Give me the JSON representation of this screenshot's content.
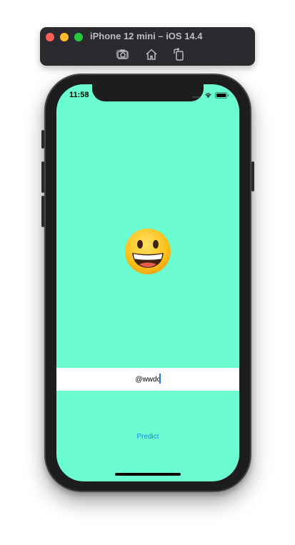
{
  "simulator": {
    "title": "iPhone 12 mini – iOS 14.4",
    "tools": [
      {
        "name": "screenshot-icon"
      },
      {
        "name": "home-icon"
      },
      {
        "name": "rotate-icon"
      }
    ]
  },
  "status_bar": {
    "time": "11:58",
    "icons": [
      "cellular-signal-icon",
      "wifi-icon",
      "battery-icon"
    ]
  },
  "main": {
    "emoji": "grinning-face-emoji",
    "text_field": {
      "value": "@wwdc"
    },
    "predict_label": "Predict"
  },
  "colors": {
    "screen_background": "#6bfdcf",
    "button_tint": "#1e7df6",
    "field_background": "#ffffff"
  }
}
